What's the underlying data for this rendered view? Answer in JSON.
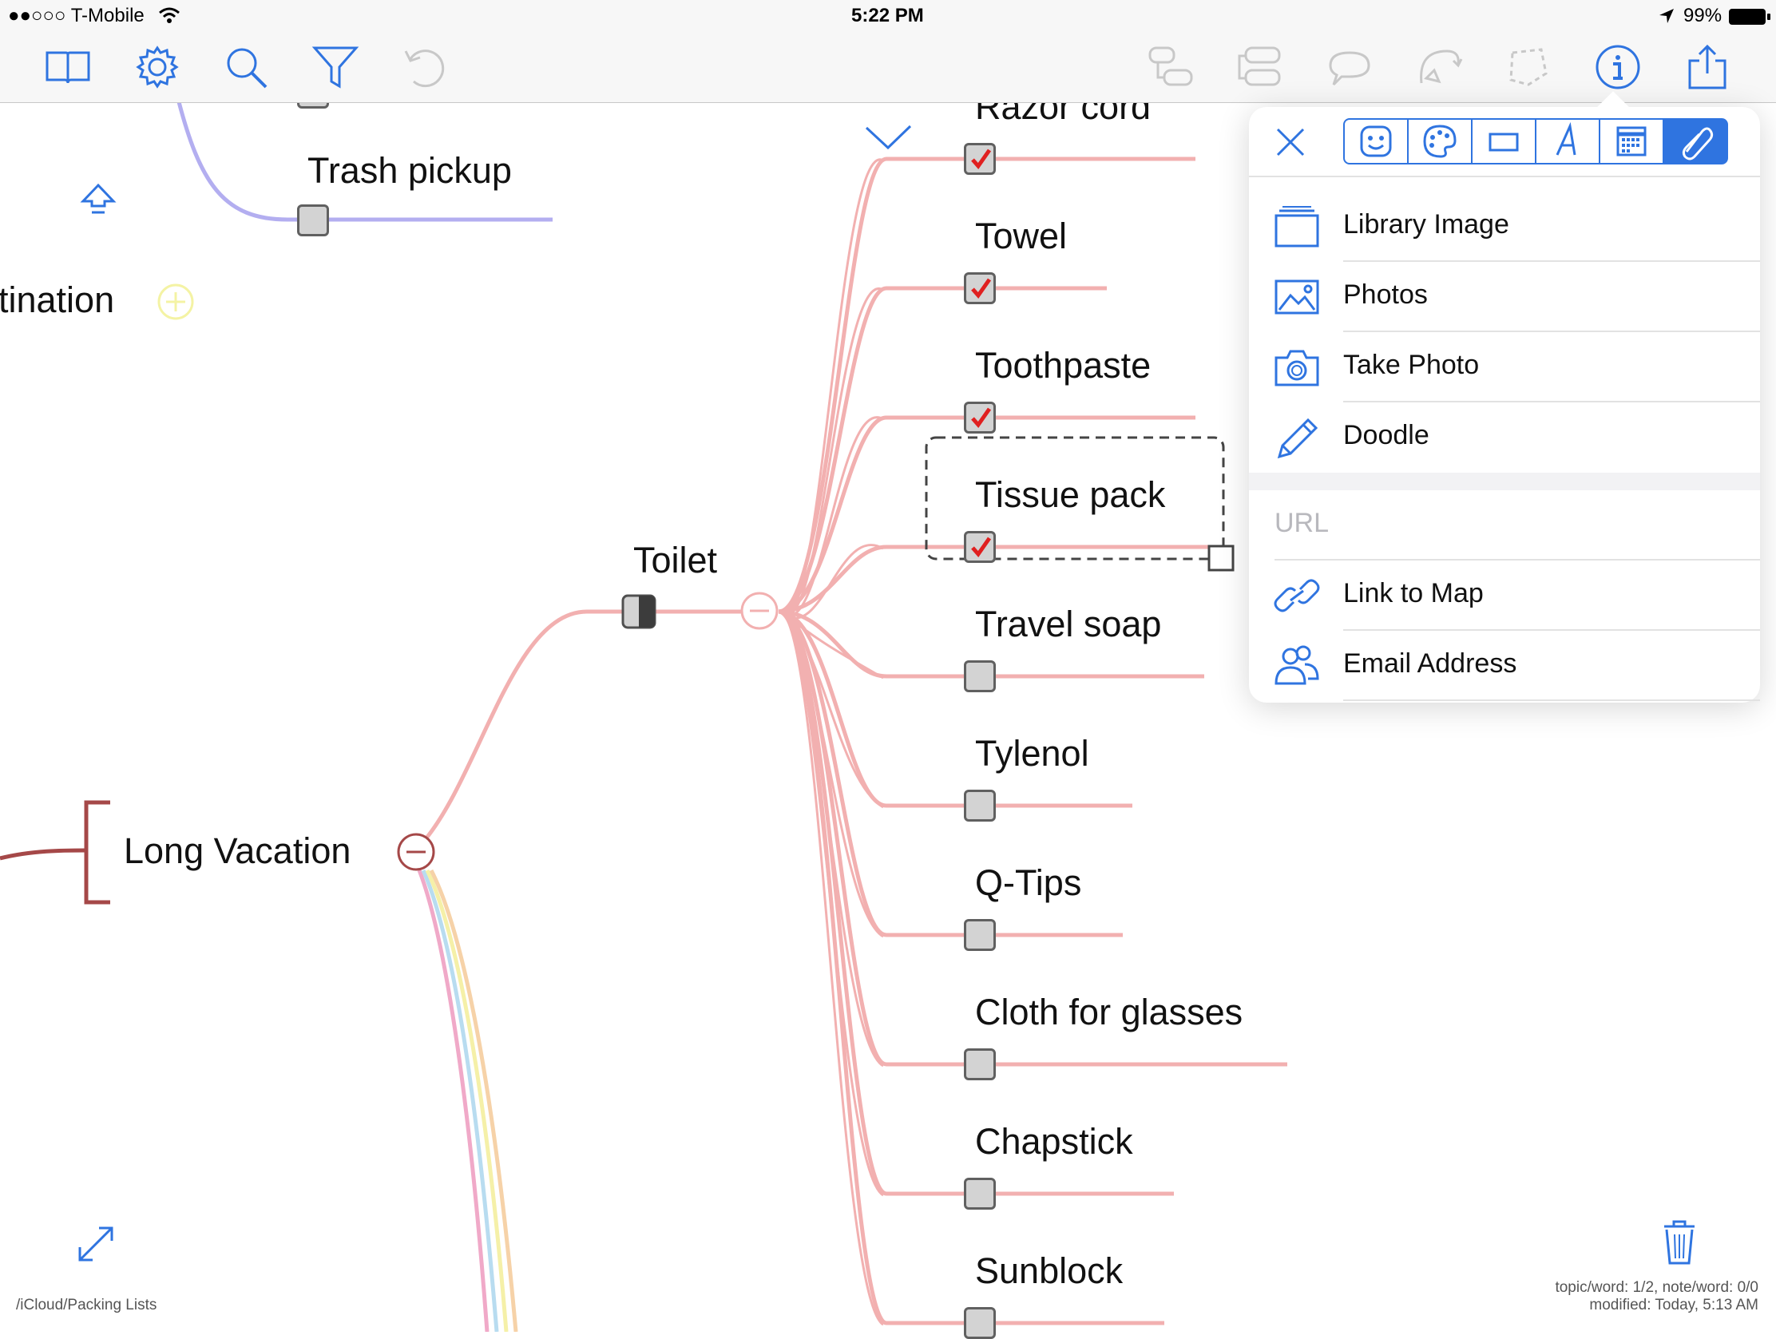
{
  "status_bar": {
    "carrier": "●●○○○ T-Mobile",
    "time": "5:22 PM",
    "battery": "99%"
  },
  "toolbar": {
    "left_icons": [
      "book-icon",
      "gear-icon",
      "search-icon",
      "filter-icon",
      "undo-icon"
    ],
    "right_icons": [
      "callout-icon",
      "boundary-icon",
      "comment-icon",
      "relationship-icon",
      "lasso-icon",
      "info-icon",
      "share-icon"
    ]
  },
  "map": {
    "top_topic": "Trash pickup",
    "partial_topic": "tination",
    "central_topic": "Long Vacation",
    "subtopic": "Toilet",
    "items": [
      {
        "label": "Razor cord",
        "checked": true
      },
      {
        "label": "Towel",
        "checked": true
      },
      {
        "label": "Toothpaste",
        "checked": true
      },
      {
        "label": "Tissue pack",
        "checked": true
      },
      {
        "label": "Travel soap",
        "checked": false
      },
      {
        "label": "Tylenol",
        "checked": false
      },
      {
        "label": "Q-Tips",
        "checked": false
      },
      {
        "label": "Cloth for glasses",
        "checked": false
      },
      {
        "label": "Chapstick",
        "checked": false
      },
      {
        "label": "Sunblock",
        "checked": false
      }
    ]
  },
  "popover": {
    "tabs": [
      "emoji-icon",
      "palette-icon",
      "rectangle-icon",
      "font-icon",
      "calendar-icon",
      "attachment-icon"
    ],
    "items": [
      {
        "label": "Library Image",
        "icon": "library-icon"
      },
      {
        "label": "Photos",
        "icon": "photos-icon"
      },
      {
        "label": "Take Photo",
        "icon": "camera-icon"
      },
      {
        "label": "Doodle",
        "icon": "pencil-icon"
      }
    ],
    "url_placeholder": "URL",
    "link_items": [
      {
        "label": "Link to Map",
        "icon": "link-icon"
      },
      {
        "label": "Email Address",
        "icon": "contacts-icon"
      }
    ]
  },
  "footer": {
    "path": "/iCloud/Packing Lists",
    "stats_line1": "topic/word: 1/2, note/word: 0/0",
    "stats_line2": "modified: Today, 5:13 AM"
  },
  "colors": {
    "accent": "#2f74e0",
    "branch_pink": "#f2b0b0",
    "branch_purple": "#b3aef0",
    "central_red": "#a54848",
    "check_red": "#e02020"
  }
}
